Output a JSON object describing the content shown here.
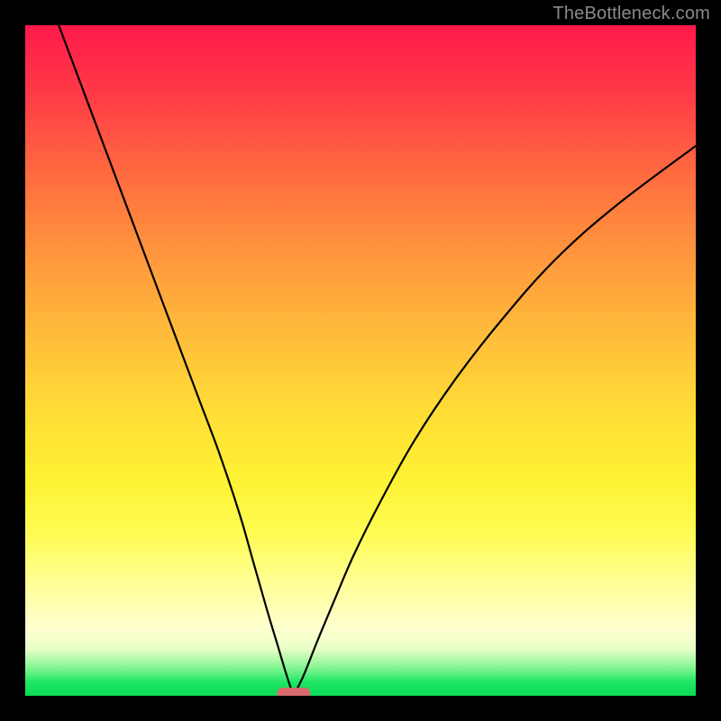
{
  "watermark": {
    "text": "TheBottleneck.com"
  },
  "colors": {
    "frame": "#000000",
    "curve": "#000000",
    "marker": "#d86a6e",
    "gradient_top": "#ff1a4b",
    "gradient_bottom": "#0bdc57"
  },
  "chart_data": {
    "type": "line",
    "title": "",
    "xlabel": "",
    "ylabel": "",
    "xlim": [
      0,
      100
    ],
    "ylim": [
      0,
      100
    ],
    "grid": false,
    "legend": false,
    "min_x": 40,
    "marker": {
      "x": 40,
      "y": 0,
      "width_pct": 5
    },
    "series": [
      {
        "name": "left-branch",
        "x": [
          5,
          8,
          11,
          14,
          17,
          20,
          23,
          26,
          29,
          32,
          34,
          36,
          37.5,
          39,
          40
        ],
        "y": [
          100,
          92,
          84,
          76,
          68,
          60,
          52,
          44,
          36,
          27,
          20,
          13,
          8,
          3,
          0
        ]
      },
      {
        "name": "right-branch",
        "x": [
          40,
          41.5,
          43.5,
          46,
          49,
          53,
          58,
          64,
          71,
          79,
          88,
          100
        ],
        "y": [
          0,
          3,
          8,
          14,
          21,
          29,
          38,
          47,
          56,
          65,
          73,
          82
        ]
      }
    ]
  }
}
